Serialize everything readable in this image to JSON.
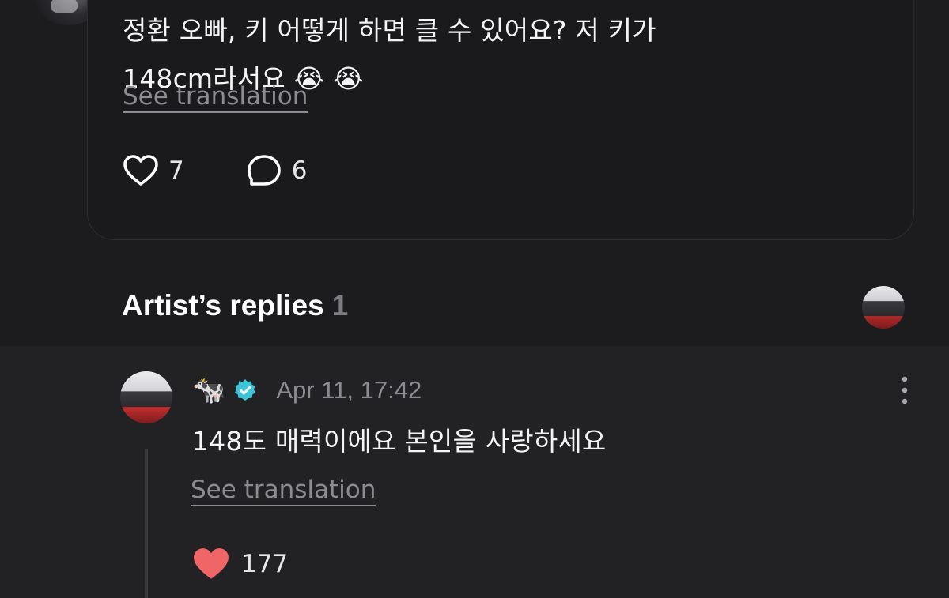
{
  "post": {
    "text_line1": "정환 오빠, 키 어떻게 하면 클 수 있어요? 저 키가",
    "text_line2": "148cm라서요 😭 😭",
    "see_translation": "See translation",
    "likes": "7",
    "comments": "6",
    "icons": {
      "like": "heart-outline-icon",
      "comment": "speech-bubble-icon"
    }
  },
  "artist_replies": {
    "title": "Artist’s replies",
    "count": "1"
  },
  "reply": {
    "author": "🐄",
    "verified_icon": "verified-badge-icon",
    "timestamp": "Apr 11, 17:42",
    "text": "148도 매력이에요 본인을 사랑하세요",
    "see_translation": "See translation",
    "likes": "177",
    "like_color": "#f06565",
    "verified_color": "#3fc3d6"
  },
  "colors": {
    "background": "#1c1c1e",
    "reply_background": "#222224",
    "muted_text": "#8b8b90"
  }
}
